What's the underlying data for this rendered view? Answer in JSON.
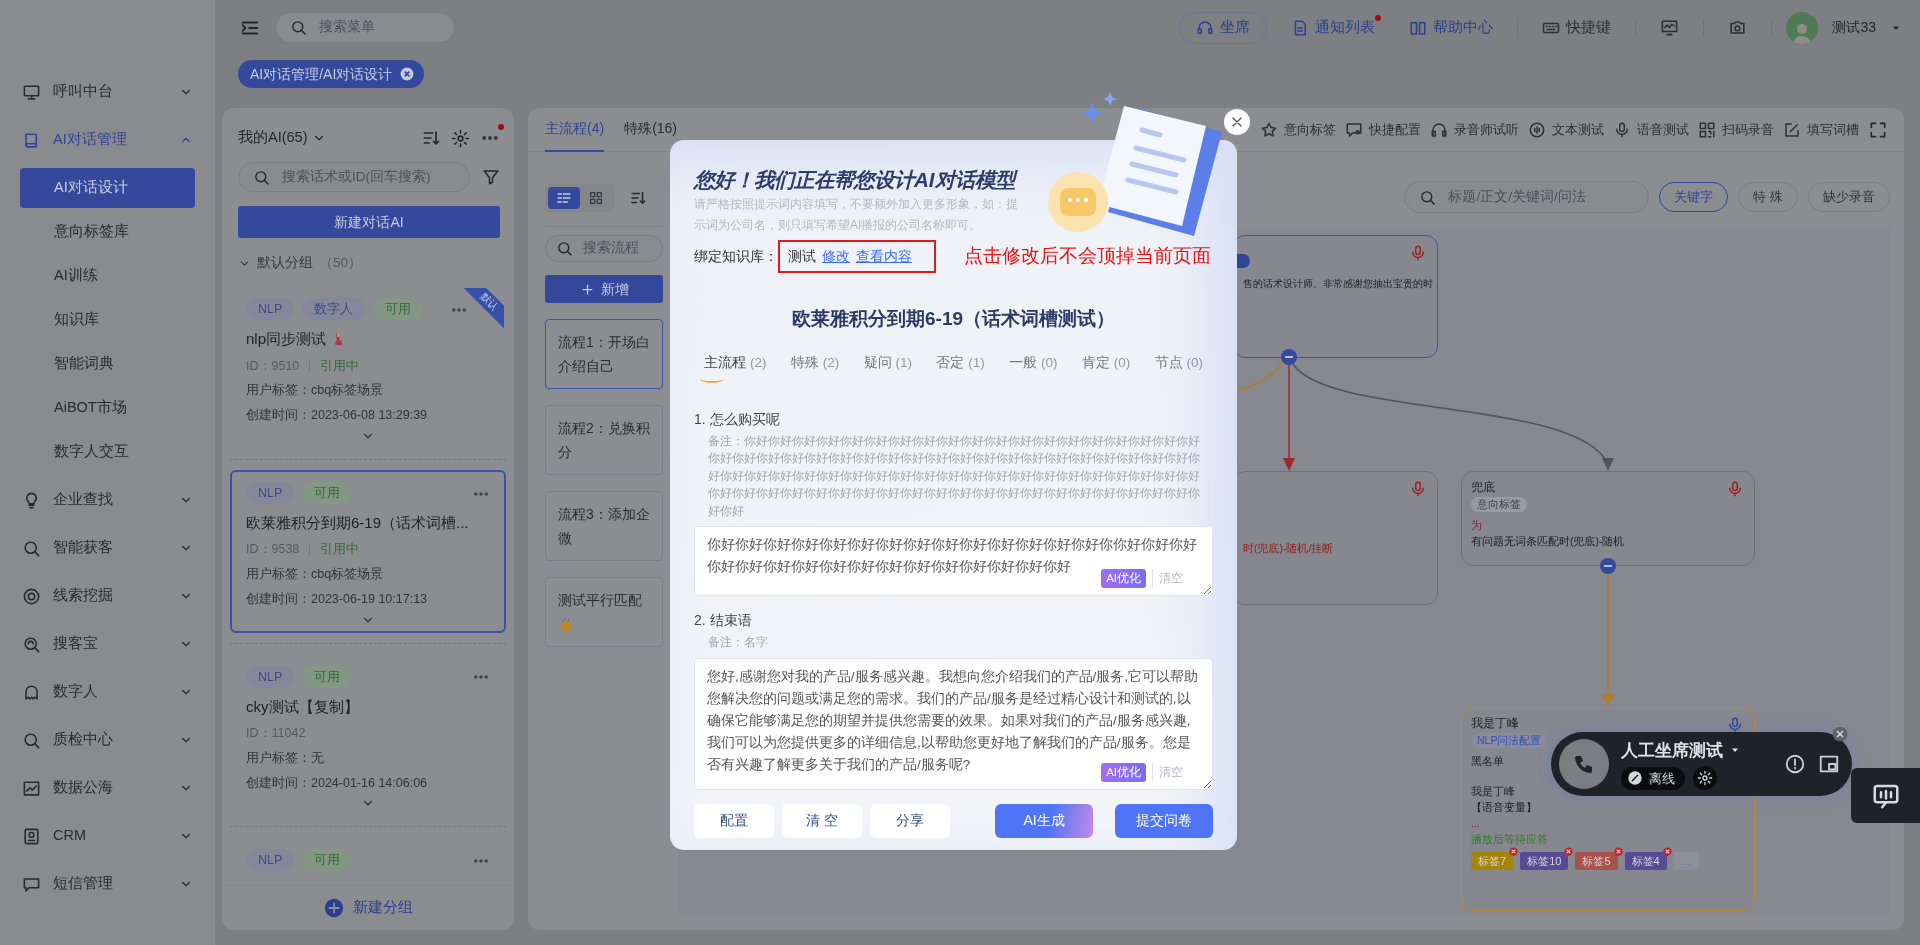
{
  "sidebar": {
    "items": [
      {
        "label": "呼叫中台",
        "selected": false,
        "expanded": false
      },
      {
        "label": "AI对话管理",
        "selected": true,
        "expanded": true,
        "children": [
          {
            "label": "AI对话设计",
            "selected": true
          },
          {
            "label": "意向标签库",
            "selected": false
          },
          {
            "label": "AI训练",
            "selected": false
          },
          {
            "label": "知识库",
            "selected": false
          },
          {
            "label": "智能词典",
            "selected": false
          },
          {
            "label": "AiBOT市场",
            "selected": false
          },
          {
            "label": "数字人交互",
            "selected": false
          }
        ]
      },
      {
        "label": "企业查找",
        "selected": false,
        "expanded": false
      },
      {
        "label": "智能获客",
        "selected": false,
        "expanded": false
      },
      {
        "label": "线索挖掘",
        "selected": false,
        "expanded": false
      },
      {
        "label": "搜客宝",
        "selected": false,
        "expanded": false
      },
      {
        "label": "数字人",
        "selected": false,
        "expanded": false
      },
      {
        "label": "质检中心",
        "selected": false,
        "expanded": false
      },
      {
        "label": "数据公海",
        "selected": false,
        "expanded": false
      },
      {
        "label": "CRM",
        "selected": false,
        "expanded": false
      },
      {
        "label": "短信管理",
        "selected": false,
        "expanded": false
      }
    ]
  },
  "topbar": {
    "search": {
      "placeholder": "搜索菜单"
    },
    "actions": [
      {
        "kind": "seat",
        "label": "坐席",
        "unread": false
      },
      {
        "kind": "notify",
        "label": "通知列表",
        "unread": true
      },
      {
        "kind": "help",
        "label": "帮助中心",
        "unread": false
      },
      {
        "kind": "keys",
        "label": "快捷键",
        "unread": false
      },
      {
        "kind": "monitor",
        "unread": false
      },
      {
        "kind": "capture",
        "unread": false
      }
    ],
    "user": {
      "name": "测试33"
    }
  },
  "open_tabs": [
    {
      "label": "AI对话管理/AI对话设计",
      "selected": true
    }
  ],
  "ai_panel": {
    "title": "我的AI(65)",
    "alert": true,
    "search": {
      "placeholder": "搜索话术或ID(回车搜索)"
    },
    "create_button": "新建对话AI",
    "group": {
      "label": "默认分组",
      "count": "（50）",
      "expanded": true
    },
    "cards": [
      {
        "tags": [
          {
            "label": "NLP",
            "kind": "nlp"
          },
          {
            "label": "数字人",
            "kind": "nlp"
          },
          {
            "label": "可用",
            "kind": "ok"
          }
        ],
        "ribbon": "默认",
        "title": "nlp同步测试",
        "decorated": true,
        "id": "ID：9510",
        "status": "引用中",
        "user_tag": "用户标签：cbq标签场景",
        "created": "创建时间：2023-06-08 13:29:39",
        "selected": false
      },
      {
        "tags": [
          {
            "label": "NLP",
            "kind": "nlp"
          },
          {
            "label": "可用",
            "kind": "ok"
          }
        ],
        "title": "欧莱雅积分到期6-19（话术词槽...",
        "decorated": false,
        "id": "ID：9538",
        "status": "引用中",
        "user_tag": "用户标签：cbq标签场景",
        "created": "创建时间：2023-06-19 10:17:13",
        "selected": true
      },
      {
        "tags": [
          {
            "label": "NLP",
            "kind": "nlp"
          },
          {
            "label": "可用",
            "kind": "ok"
          }
        ],
        "title": "cky测试【复制】",
        "decorated": false,
        "id": "ID：11042",
        "user_tag": "用户标签：无",
        "created": "创建时间：2024-01-16 14:06:06",
        "selected": false
      },
      {
        "tags": [
          {
            "label": "NLP",
            "kind": "nlp"
          },
          {
            "label": "可用",
            "kind": "ok"
          }
        ],
        "selected": false
      }
    ],
    "new_group": "新建分组"
  },
  "main": {
    "tabs": [
      {
        "label": "主流程(4)",
        "selected": true
      },
      {
        "label": "特殊(16)",
        "selected": false
      }
    ],
    "tools": [
      {
        "label": "意向标签"
      },
      {
        "label": "快捷配置"
      },
      {
        "label": "录音师试听"
      },
      {
        "label": "文本测试"
      },
      {
        "label": "语音测试"
      },
      {
        "label": "扫码录音"
      },
      {
        "label": "填写词槽"
      }
    ],
    "view_toggle": [
      {
        "selected": true
      },
      {
        "selected": false
      }
    ],
    "flows": {
      "search": {
        "placeholder": "搜索流程"
      },
      "add_button": "新增",
      "items": [
        {
          "label": "流程1：开场白介绍自己",
          "selected": true,
          "decorated": false
        },
        {
          "label": "流程2：兑换积分",
          "selected": false,
          "decorated": false
        },
        {
          "label": "流程3：添加企微",
          "selected": false,
          "decorated": false
        },
        {
          "label": "测试平行匹配",
          "selected": false,
          "decorated": true
        }
      ]
    },
    "filter": {
      "search": {
        "placeholder": "标题/正文/关键词/问法"
      },
      "chips": [
        {
          "label": "关键字",
          "selected": true
        },
        {
          "label": "特 殊",
          "selected": false
        },
        {
          "label": "缺少录音",
          "selected": false
        }
      ]
    },
    "canvas": {
      "nodes": [
        {
          "kind": "focus",
          "recorded": false,
          "texts": [
            {
              "kind": "body",
              "text": "售的话术设计师。非常感谢您抽出宝贵的时"
            }
          ]
        },
        {
          "kind": "plain",
          "recorded": false,
          "texts": [
            {
              "kind": "alert",
              "text": "时(兜底)-随机/挂断"
            }
          ]
        },
        {
          "kind": "plain",
          "recorded": false,
          "title": "兜底",
          "tags": [
            {
              "label": "意向标签",
              "kind": "muted"
            }
          ],
          "texts": [
            {
              "kind": "alert",
              "text": "为"
            },
            {
              "kind": "body",
              "text": "有问题无词条匹配时(兜底)-随机"
            }
          ]
        },
        {
          "kind": "warm",
          "recorded": true,
          "title": "我是丁峰",
          "tags": [
            {
              "label": "NLP问法配置",
              "kind": "link"
            }
          ],
          "texts": [
            {
              "kind": "body",
              "text": "黑名单"
            },
            {
              "kind": "body",
              "text": "我是丁峰"
            },
            {
              "kind": "body",
              "text": "【语音变量】"
            },
            {
              "kind": "alert",
              "text": "..."
            },
            {
              "kind": "ok",
              "text": "播放后等待应答"
            }
          ],
          "labels": [
            {
              "label": "标签7",
              "color": "#a3850a"
            },
            {
              "label": "标签10",
              "color": "#584a98"
            },
            {
              "label": "标签5",
              "color": "#a9524a"
            },
            {
              "label": "标签4",
              "color": "#584a98"
            }
          ],
          "more": "..."
        }
      ]
    }
  },
  "phone": {
    "title": "人工坐席测试",
    "status": "离线"
  },
  "modal": {
    "heading": "您好！我们正在帮您设计AI对话模型",
    "hint": "请严格按照提示词内容填写，不要额外加入更多形象，如：提示词为公司名，则只填写希望AI播报的公司名称即可。",
    "kb": {
      "label": "绑定知识库：",
      "value": "测试",
      "links": [
        "修改",
        "查看内容"
      ]
    },
    "annotation": "点击修改后不会顶掉当前页面",
    "title": "欧莱雅积分到期6-19（话术词槽测试）",
    "tabs": [
      {
        "label": "主流程",
        "count": "(2)",
        "selected": true
      },
      {
        "label": "特殊",
        "count": "(2)",
        "selected": false
      },
      {
        "label": "疑问",
        "count": "(1)",
        "selected": false
      },
      {
        "label": "否定",
        "count": "(1)",
        "selected": false
      },
      {
        "label": "一般",
        "count": "(0)",
        "selected": false
      },
      {
        "label": "肯定",
        "count": "(0)",
        "selected": false
      },
      {
        "label": "节点",
        "count": "(0)",
        "selected": false
      }
    ],
    "questions": [
      {
        "label": "1. 怎么购买呢",
        "note": "备注：你好你好你好你好你好你好你好你好你好你好你好你好你好你好你好你好你好你好你好你好你好你好你好你好你好你好你好你好你好你好你好你好你好你好你好你好你好你好你好你好你好你好你好你好你好你好你好你好你好你好你好你好你好你好你好你好你好你好你好你好你好你好你好你好你好你好你好你好你好你好你好你好你好你好你好你好你好你好你好你好你好你好",
        "answer": "你好你好你好你好你好你好你好你好你好你好你好你好你好你好你你好你好你好你好你好你好你好你好你好你好你好你好你好你好你好你好",
        "optimize": "AI优化",
        "clear": "清空"
      },
      {
        "label": "2. 结束语",
        "note": "备注：名字",
        "answer": "您好,感谢您对我的产品/服务感兴趣。我想向您介绍我们的产品/服务,它可以帮助您解决您的问题或满足您的需求。我们的产品/服务是经过精心设计和测试的,以确保它能够满足您的期望并提供您需要的效果。如果对我们的产品/服务感兴趣,我们可以为您提供更多的详细信息,以帮助您更好地了解我们的产品/服务。您是否有兴趣了解更多关于我们的产品/服务呢?",
        "optimize": "AI优化",
        "clear": "清空"
      }
    ],
    "buttons": [
      {
        "label": "配置",
        "kind": "plain"
      },
      {
        "label": "清 空",
        "kind": "plain"
      },
      {
        "label": "分享",
        "kind": "plain"
      },
      {
        "label": "AI生成",
        "kind": "gradient"
      },
      {
        "label": "提交问卷",
        "kind": "primary"
      }
    ]
  }
}
